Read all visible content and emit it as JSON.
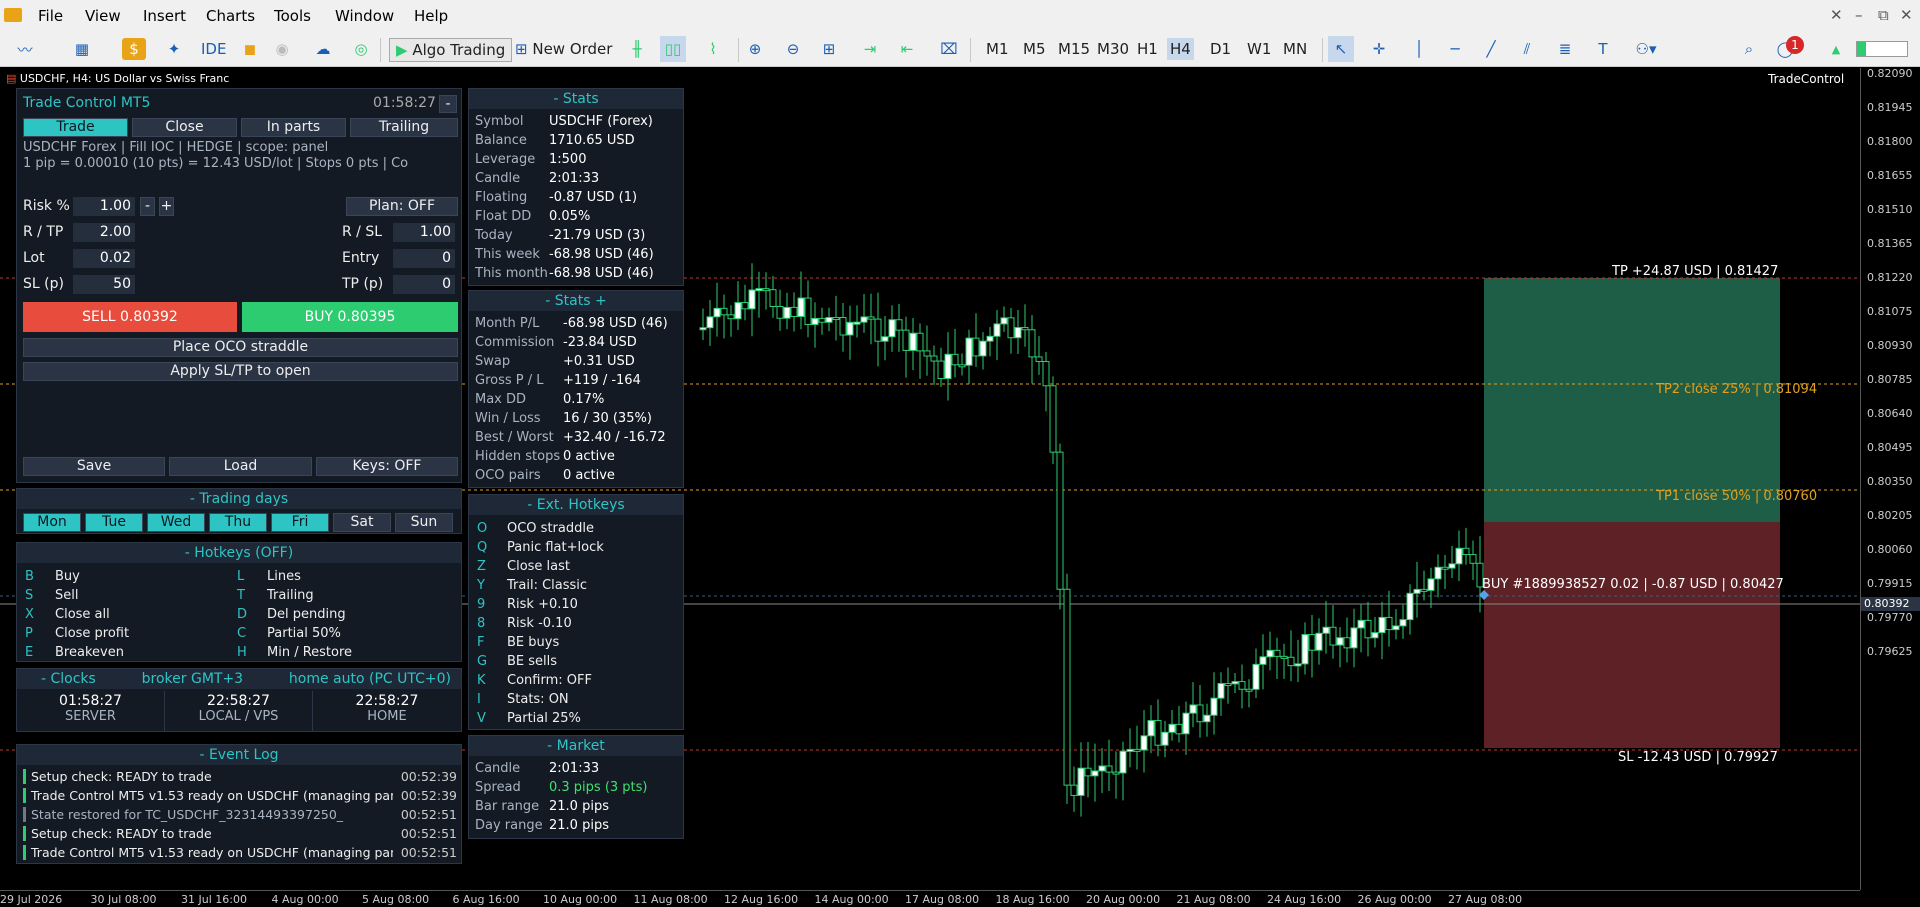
{
  "menu": [
    "File",
    "View",
    "Insert",
    "Charts",
    "Tools",
    "Window",
    "Help"
  ],
  "toolbar": {
    "algo_trading": "Algo Trading",
    "new_order": "New Order",
    "ide": "IDE",
    "timeframes": [
      "M1",
      "M5",
      "M15",
      "M30",
      "H1",
      "H4",
      "D1",
      "W1",
      "MN"
    ],
    "active_tf": "H4",
    "notifications": "1"
  },
  "chart": {
    "symbol_title": "USDCHF, H4:  US Dollar vs Swiss Franc",
    "indicator_name": "TradeControl",
    "price_labels": [
      "0.82090",
      "0.81945",
      "0.81800",
      "0.81655",
      "0.81510",
      "0.81365",
      "0.81220",
      "0.81075",
      "0.80930",
      "0.80785",
      "0.80640",
      "0.80495",
      "0.80350",
      "0.80205",
      "0.80060",
      "0.79915",
      "0.79770",
      "0.79625"
    ],
    "current_price": "0.80392",
    "time_labels": [
      "29 Jul 2026",
      "30 Jul 08:00",
      "31 Jul 16:00",
      "4 Aug 00:00",
      "5 Aug 08:00",
      "6 Aug 16:00",
      "10 Aug 00:00",
      "11 Aug 08:00",
      "12 Aug 16:00",
      "14 Aug 00:00",
      "17 Aug 08:00",
      "18 Aug 16:00",
      "20 Aug 00:00",
      "21 Aug 08:00",
      "24 Aug 16:00",
      "26 Aug 00:00",
      "27 Aug 08:00"
    ],
    "tp_label": "TP +24.87 USD  |  0.81427",
    "tp2_label": "TP2  close 25%  |  0.81094",
    "tp1_label": "TP1  close 50%  |  0.80760",
    "buy_label": "BUY #1889938527  0.02  |  -0.87 USD  |  0.80427",
    "sl_label": "SL  -12.43 USD  |  0.79927",
    "colors": {
      "bull": "#ffffff",
      "bear": "#000000",
      "wick": "#2ecc71",
      "tp_zone": "#1f5e46",
      "sl_zone": "#5e2226",
      "tp_line": "#c0392b",
      "tp_levels": "#e0a020"
    }
  },
  "trade_panel": {
    "title": "Trade Control MT5",
    "timer": "01:58:27",
    "minimize": "-",
    "tabs": [
      "Trade",
      "Close",
      "In parts",
      "Trailing"
    ],
    "info1": "USDCHF  Forex  |  Fill IOC  |  HEDGE  |  scope: panel",
    "info2": "1 pip = 0.00010 (10 pts) = 12.43 USD/lot  |  Stops 0 pts  |  Co",
    "risk_label": "Risk %",
    "risk": "1.00",
    "minus": "-",
    "plus": "+",
    "plan": "Plan: OFF",
    "rtp_label": "R / TP",
    "rtp": "2.00",
    "rsl_label": "R / SL",
    "rsl": "1.00",
    "lot_label": "Lot",
    "lot": "0.02",
    "entry_label": "Entry",
    "entry": "0",
    "sl_label": "SL (p)",
    "sl": "50",
    "tp_label": "TP (p)",
    "tp": "0",
    "sell": "SELL  0.80392",
    "buy": "BUY  0.80395",
    "oco": "Place OCO straddle",
    "apply": "Apply SL/TP to open",
    "save": "Save",
    "load": "Load",
    "keys": "Keys: OFF"
  },
  "trading_days": {
    "title": "- Trading days",
    "days": [
      "Mon",
      "Tue",
      "Wed",
      "Thu",
      "Fri",
      "Sat",
      "Sun"
    ]
  },
  "hotkeys": {
    "title": "- Hotkeys (OFF)",
    "left": [
      [
        "B",
        "Buy"
      ],
      [
        "S",
        "Sell"
      ],
      [
        "X",
        "Close all"
      ],
      [
        "P",
        "Close profit"
      ],
      [
        "E",
        "Breakeven"
      ]
    ],
    "right": [
      [
        "L",
        "Lines"
      ],
      [
        "T",
        "Trailing"
      ],
      [
        "D",
        "Del pending"
      ],
      [
        "C",
        "Partial 50%"
      ],
      [
        "H",
        "Min / Restore"
      ]
    ]
  },
  "clocks": {
    "title": "- Clocks",
    "broker": "broker GMT+3",
    "home": "home auto (PC UTC+0)",
    "items": [
      [
        "01:58:27",
        "SERVER"
      ],
      [
        "22:58:27",
        "LOCAL / VPS"
      ],
      [
        "22:58:27",
        "HOME"
      ]
    ]
  },
  "event_log": {
    "title": "- Event Log",
    "items": [
      [
        "Setup check: READY to trade",
        "00:52:39"
      ],
      [
        "Trade Control MT5 v1.53 ready on USDCHF (managing pan...",
        "00:52:39"
      ],
      [
        "State restored for TC_USDCHF_32314493397250_",
        "00:52:51"
      ],
      [
        "Setup check: READY to trade",
        "00:52:51"
      ],
      [
        "Trade Control MT5 v1.53 ready on USDCHF (managing pan...",
        "00:52:51"
      ]
    ]
  },
  "stats": {
    "title": "- Stats",
    "items": [
      [
        "Symbol",
        "USDCHF  (Forex)"
      ],
      [
        "Balance",
        "1710.65 USD"
      ],
      [
        "Leverage",
        "1:500"
      ],
      [
        "Candle",
        "2:01:33"
      ],
      [
        "Floating",
        "-0.87 USD (1)"
      ],
      [
        "Float DD",
        "0.05%"
      ],
      [
        "Today",
        "-21.79 USD (3)"
      ],
      [
        "This week",
        "-68.98 USD (46)"
      ],
      [
        "This month",
        "-68.98 USD (46)"
      ]
    ]
  },
  "stats_plus": {
    "title": "- Stats +",
    "items": [
      [
        "Month P/L",
        "-68.98 USD (46)"
      ],
      [
        "Commission",
        "-23.84 USD"
      ],
      [
        "Swap",
        "+0.31 USD"
      ],
      [
        "Gross P / L",
        "+119 / -164"
      ],
      [
        "Max DD",
        "0.17%"
      ],
      [
        "Win / Loss",
        "16 / 30  (35%)"
      ],
      [
        "Best / Worst",
        "+32.40 / -16.72"
      ],
      [
        "Hidden stops",
        "0 active"
      ],
      [
        "OCO pairs",
        "0 active"
      ]
    ]
  },
  "ext_hotkeys": {
    "title": "- Ext. Hotkeys",
    "items": [
      [
        "O",
        "OCO straddle"
      ],
      [
        "Q",
        "Panic flat+lock"
      ],
      [
        "Z",
        "Close last"
      ],
      [
        "Y",
        "Trail: Classic"
      ],
      [
        "9",
        "Risk +0.10"
      ],
      [
        "8",
        "Risk -0.10"
      ],
      [
        "F",
        "BE buys"
      ],
      [
        "G",
        "BE sells"
      ],
      [
        "K",
        "Confirm: OFF"
      ],
      [
        "I",
        "Stats: ON"
      ],
      [
        "V",
        "Partial 25%"
      ]
    ]
  },
  "market": {
    "title": "- Market",
    "items": [
      [
        "Candle",
        "2:01:33"
      ],
      [
        "Spread",
        "0.3 pips (3 pts)"
      ],
      [
        "Bar range",
        "21.0 pips"
      ],
      [
        "Day range",
        "21.0 pips"
      ]
    ]
  }
}
